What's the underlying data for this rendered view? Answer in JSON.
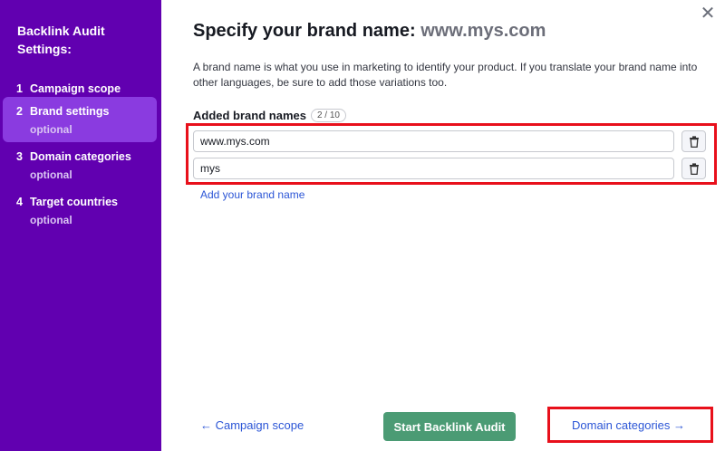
{
  "sidebar": {
    "title": "Backlink Audit Settings:",
    "steps": [
      {
        "number": "1",
        "label": "Campaign scope",
        "optional": ""
      },
      {
        "number": "2",
        "label": "Brand settings",
        "optional": "optional"
      },
      {
        "number": "3",
        "label": "Domain categories",
        "optional": "optional"
      },
      {
        "number": "4",
        "label": "Target countries",
        "optional": "optional"
      }
    ],
    "active_step": 2
  },
  "close_icon": "close-icon",
  "main": {
    "heading_prefix": "Specify your brand name:",
    "heading_domain": "www.mys.com",
    "description": "A brand name is what you use in marketing to identify your product. If you translate your brand name into other languages, be sure to add those variations too.",
    "added_label": "Added brand names",
    "count": "2 / 10",
    "brand_names": [
      "www.mys.com",
      "mys"
    ],
    "add_link": "Add your brand name"
  },
  "footer": {
    "back_label": "← Campaign scope",
    "start_label": "Start Backlink Audit",
    "next_label": "Domain categories →"
  },
  "colors": {
    "sidebar_bg": "#6100b0",
    "active_step_bg": "#8a3be0",
    "link": "#2b55d6",
    "start_button": "#4b9b74",
    "highlight": "#e8101b"
  }
}
